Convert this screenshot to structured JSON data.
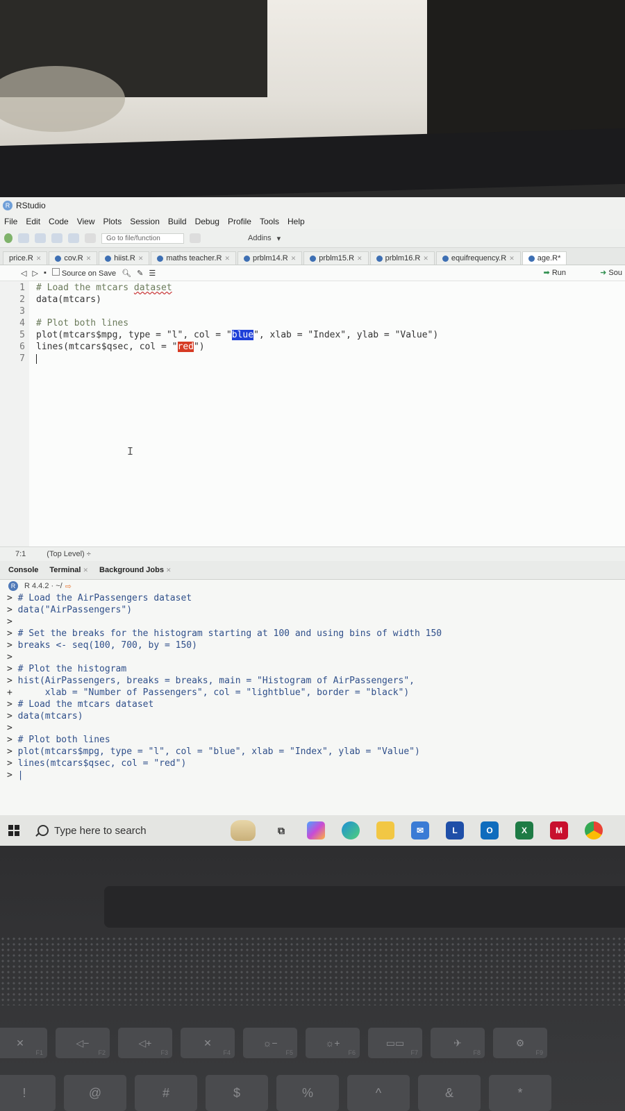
{
  "app": {
    "title": "RStudio"
  },
  "menu": [
    "File",
    "Edit",
    "Code",
    "View",
    "Plots",
    "Session",
    "Build",
    "Debug",
    "Profile",
    "Tools",
    "Help"
  ],
  "toolbar": {
    "goto_placeholder": "Go to file/function",
    "addins": "Addins"
  },
  "tabs": [
    {
      "label": "price.R",
      "active": false
    },
    {
      "label": "cov.R",
      "active": false
    },
    {
      "label": "hiist.R",
      "active": false
    },
    {
      "label": "maths teacher.R",
      "active": false
    },
    {
      "label": "prblm14.R",
      "active": false
    },
    {
      "label": "prblm15.R",
      "active": false
    },
    {
      "label": "prblm16.R",
      "active": false
    },
    {
      "label": "equifrequency.R",
      "active": false
    },
    {
      "label": "age.R*",
      "active": true
    }
  ],
  "editor_toolbar": {
    "source_on_save": "Source on Save",
    "run": "Run",
    "source": "Sou"
  },
  "editor": {
    "lines": [
      {
        "n": "1",
        "a": "# Load the mtcars ",
        "b": "dataset",
        "c": "",
        "d": "",
        "e": "",
        "kind": "comment"
      },
      {
        "n": "2",
        "a": "data(mtcars)",
        "b": "",
        "c": "",
        "d": "",
        "e": "",
        "kind": "code"
      },
      {
        "n": "3",
        "a": "",
        "b": "",
        "c": "",
        "d": "",
        "e": "",
        "kind": "code"
      },
      {
        "n": "4",
        "a": "# Plot both lines",
        "b": "",
        "c": "",
        "d": "",
        "e": "",
        "kind": "comment"
      },
      {
        "n": "5",
        "a": "plot(mtcars$mpg, type = \"l\", col = \"",
        "b": "blue",
        "c": "\", xlab = \"Index\", ylab = \"Value\")",
        "d": "",
        "e": "",
        "kind": "blue"
      },
      {
        "n": "6",
        "a": "lines(mtcars$qsec, col = \"",
        "b": "red",
        "c": "\")",
        "d": "",
        "e": "",
        "kind": "red"
      },
      {
        "n": "7",
        "a": "",
        "b": "",
        "c": "",
        "d": "",
        "e": "",
        "kind": "cursor"
      }
    ]
  },
  "status": {
    "position": "7:1",
    "scope": "(Top Level) ÷"
  },
  "console_tabs": {
    "console": "Console",
    "terminal": "Terminal",
    "jobs": "Background Jobs"
  },
  "r_version": "R 4.4.2 · ~/",
  "console": [
    {
      "p": ">",
      "t": " # Load the AirPassengers dataset"
    },
    {
      "p": ">",
      "t": " data(\"AirPassengers\")"
    },
    {
      "p": ">",
      "t": ""
    },
    {
      "p": ">",
      "t": " # Set the breaks for the histogram starting at 100 and using bins of width 150"
    },
    {
      "p": ">",
      "t": " breaks <- seq(100, 700, by = 150)"
    },
    {
      "p": ">",
      "t": ""
    },
    {
      "p": ">",
      "t": " # Plot the histogram"
    },
    {
      "p": ">",
      "t": " hist(AirPassengers, breaks = breaks, main = \"Histogram of AirPassengers\","
    },
    {
      "p": "+",
      "t": "      xlab = \"Number of Passengers\", col = \"lightblue\", border = \"black\")"
    },
    {
      "p": ">",
      "t": " # Load the mtcars dataset"
    },
    {
      "p": ">",
      "t": " data(mtcars)"
    },
    {
      "p": ">",
      "t": ""
    },
    {
      "p": ">",
      "t": " # Plot both lines"
    },
    {
      "p": ">",
      "t": " plot(mtcars$mpg, type = \"l\", col = \"blue\", xlab = \"Index\", ylab = \"Value\")"
    },
    {
      "p": ">",
      "t": " lines(mtcars$qsec, col = \"red\")"
    },
    {
      "p": ">",
      "t": " |"
    }
  ],
  "taskbar": {
    "search_placeholder": "Type here to search",
    "icons": [
      "widgets-icon",
      "task-view-icon",
      "copilot-icon",
      "edge-icon",
      "file-explorer-icon",
      "mail-icon",
      "l-app-icon",
      "outlook-icon",
      "excel-icon",
      "mcafee-icon",
      "chrome-icon"
    ]
  },
  "keyboard": {
    "fkeys": [
      {
        "g": "✕",
        "l": "F1"
      },
      {
        "g": "◁−",
        "l": "F2"
      },
      {
        "g": "◁+",
        "l": "F3"
      },
      {
        "g": "✕",
        "l": "F4"
      },
      {
        "g": "☼−",
        "l": "F5"
      },
      {
        "g": "☼+",
        "l": "F6"
      },
      {
        "g": "▭▭",
        "l": "F7"
      },
      {
        "g": "✈",
        "l": "F8"
      },
      {
        "g": "⚙",
        "l": "F9"
      }
    ],
    "numkeys": [
      "!",
      "@",
      "#",
      "$",
      "%",
      "^",
      "&",
      "*"
    ]
  }
}
